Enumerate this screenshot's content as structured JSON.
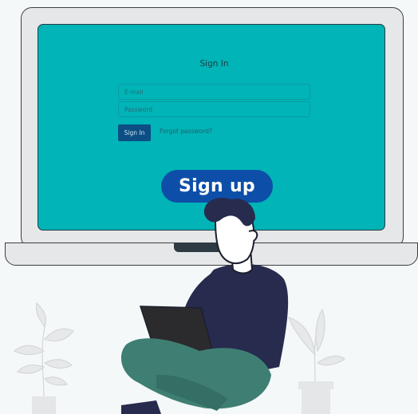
{
  "signin": {
    "title": "Sign In",
    "email_placeholder": "E-mail",
    "password_placeholder": "Password",
    "signin_label": "Sign In",
    "forgot_label": "Forgot password?"
  },
  "signup": {
    "label": "Sign up"
  },
  "colors": {
    "screen": "#00b4b7",
    "signin_button": "#0c4e84",
    "signup_button": "#0d4fa8",
    "background": "#f4f8f9"
  },
  "illustration": {
    "person": "person-with-laptop",
    "plants": [
      "plant-left",
      "plant-right"
    ]
  }
}
